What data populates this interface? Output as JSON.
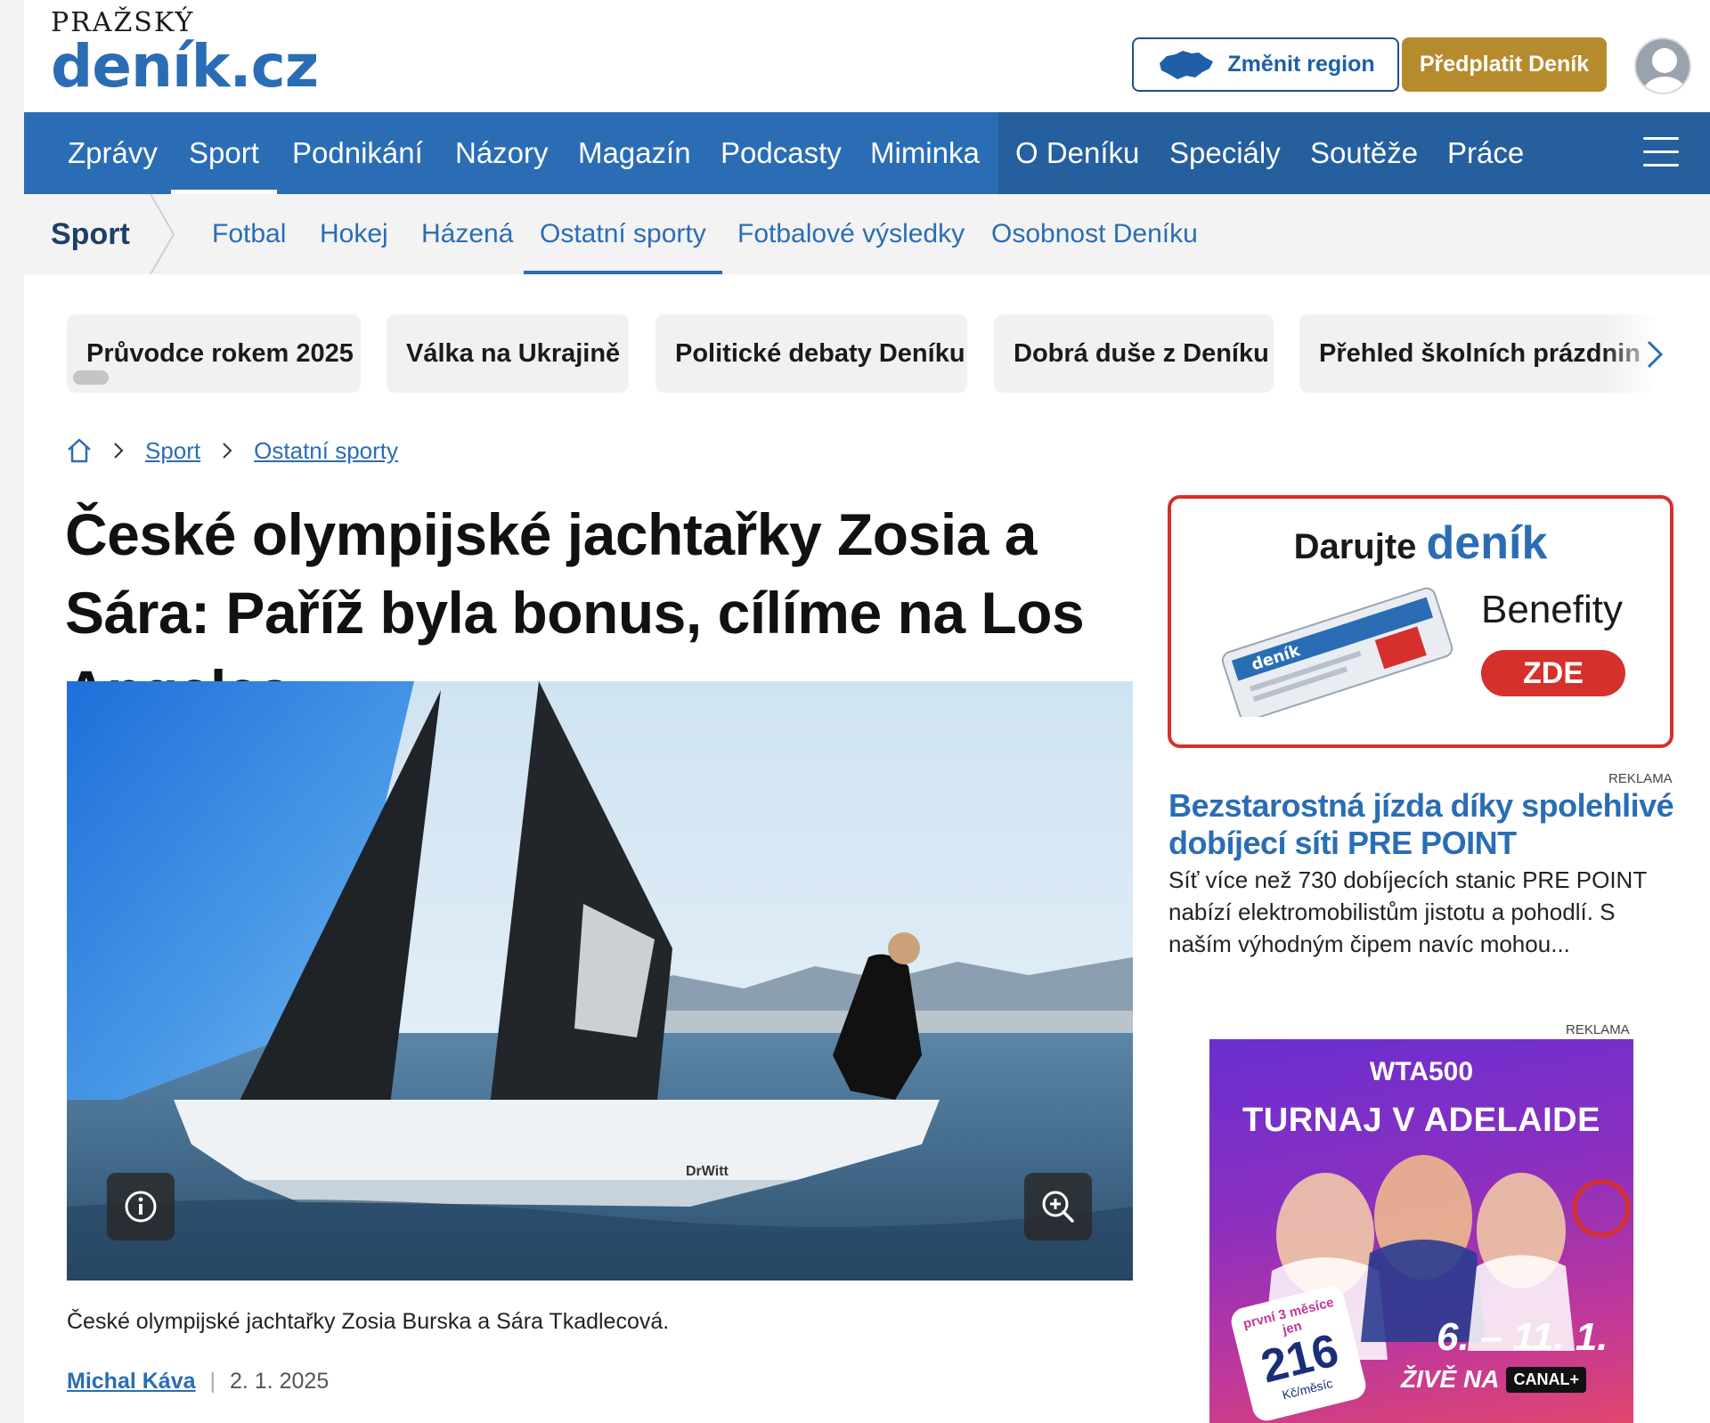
{
  "header": {
    "logo_top": "PRAŽSKÝ",
    "logo_main": "deník.cz",
    "region_button": "Změnit region",
    "subscribe_button": "Předplatit Deník"
  },
  "main_nav": {
    "items": [
      "Zprávy",
      "Sport",
      "Podnikání",
      "Názory",
      "Magazín",
      "Podcasty",
      "Miminka",
      "O Deníku",
      "Speciály",
      "Soutěže",
      "Práce"
    ],
    "active": "Sport"
  },
  "sub_nav": {
    "title": "Sport",
    "items": [
      "Fotbal",
      "Hokej",
      "Házená",
      "Ostatní sporty",
      "Fotbalové výsledky",
      "Osobnost Deníku"
    ],
    "active": "Ostatní sporty"
  },
  "topics": [
    "Průvodce rokem 2025",
    "Válka na Ukrajině",
    "Politické debaty Deníku",
    "Dobrá duše z Deníku",
    "Přehled školních prázdnin"
  ],
  "breadcrumb": [
    "Sport",
    "Ostatní sporty"
  ],
  "article": {
    "headline": "České olympijské jachtařky Zosia a Sára: Paříž byla bonus, cílíme na Los Angeles",
    "caption": "České olympijské jachtařky Zosia Burska a Sára Tkadlecová.",
    "author": "Michal Káva",
    "date": "2. 1. 2025",
    "boat_text": "DrWitt"
  },
  "promo": {
    "title_prefix": "Darujte",
    "title_brand": "deník",
    "benefits": "Benefity",
    "cta": "ZDE",
    "paper_label": "deník"
  },
  "ad_text": {
    "label": "REKLAMA",
    "title": "Bezstarostná jízda díky spolehlivé dobíjecí síti PRE POINT",
    "body": "Síť více než 730 dobíjecích stanic PRE POINT nabízí elektromobilistům jistotu a pohodlí. S naším výhodným čipem navíc mohou..."
  },
  "wta_ad": {
    "label": "REKLAMA",
    "logo": "WTA500",
    "title": "TURNAJ V ADELAIDE",
    "price_small": "první 3 měsíce jen",
    "price": "216",
    "price_unit": "Kč/měsíc",
    "dates": "6. – 11. 1.",
    "live": "ŽIVĚ NA",
    "channel": "CANAL+"
  },
  "colors": {
    "brand_blue": "#2a6db5",
    "gold": "#b68b2d",
    "promo_red": "#d5302b"
  }
}
